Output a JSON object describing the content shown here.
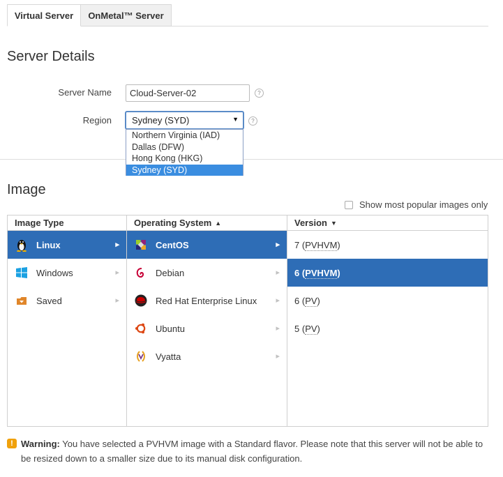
{
  "tabs": [
    {
      "label": "Virtual Server",
      "active": true
    },
    {
      "label": "OnMetal™ Server",
      "active": false
    }
  ],
  "server_details": {
    "heading": "Server Details",
    "server_name_label": "Server Name",
    "server_name_value": "Cloud-Server-02",
    "region_label": "Region",
    "region_selected": "Sydney (SYD)",
    "region_options": [
      "Northern Virginia (IAD)",
      "Dallas (DFW)",
      "Hong Kong (HKG)",
      "Sydney (SYD)"
    ],
    "help_glyph": "?"
  },
  "image": {
    "heading": "Image",
    "popular_only_label": "Show most popular images only",
    "popular_only_checked": false,
    "columns": {
      "image_type": "Image Type",
      "operating_system": "Operating System",
      "version": "Version"
    },
    "image_types": [
      {
        "label": "Linux",
        "icon": "penguin-icon",
        "selected": true
      },
      {
        "label": "Windows",
        "icon": "windows-icon",
        "selected": false
      },
      {
        "label": "Saved",
        "icon": "saved-icon",
        "selected": false
      }
    ],
    "operating_systems": [
      {
        "label": "CentOS",
        "icon": "centos-icon",
        "selected": true
      },
      {
        "label": "Debian",
        "icon": "debian-icon",
        "selected": false
      },
      {
        "label": "Red Hat Enterprise Linux",
        "icon": "redhat-icon",
        "selected": false
      },
      {
        "label": "Ubuntu",
        "icon": "ubuntu-icon",
        "selected": false
      },
      {
        "label": "Vyatta",
        "icon": "vyatta-icon",
        "selected": false
      }
    ],
    "versions": [
      {
        "num": "7",
        "type": "PVHVM",
        "selected": false
      },
      {
        "num": "6",
        "type": "PVHVM",
        "selected": true
      },
      {
        "num": "6",
        "type": "PV",
        "selected": false
      },
      {
        "num": "5",
        "type": "PV",
        "selected": false
      }
    ]
  },
  "warning": {
    "title": "Warning:",
    "message": "You have selected a PVHVM image with a Standard flavor. Please note that this server will not be able to be resized down to a smaller size due to its manual disk configuration."
  },
  "colors": {
    "selected_row": "#2e6db6",
    "dropdown_selected": "#3a8de0",
    "warning": "#f0a10c"
  }
}
